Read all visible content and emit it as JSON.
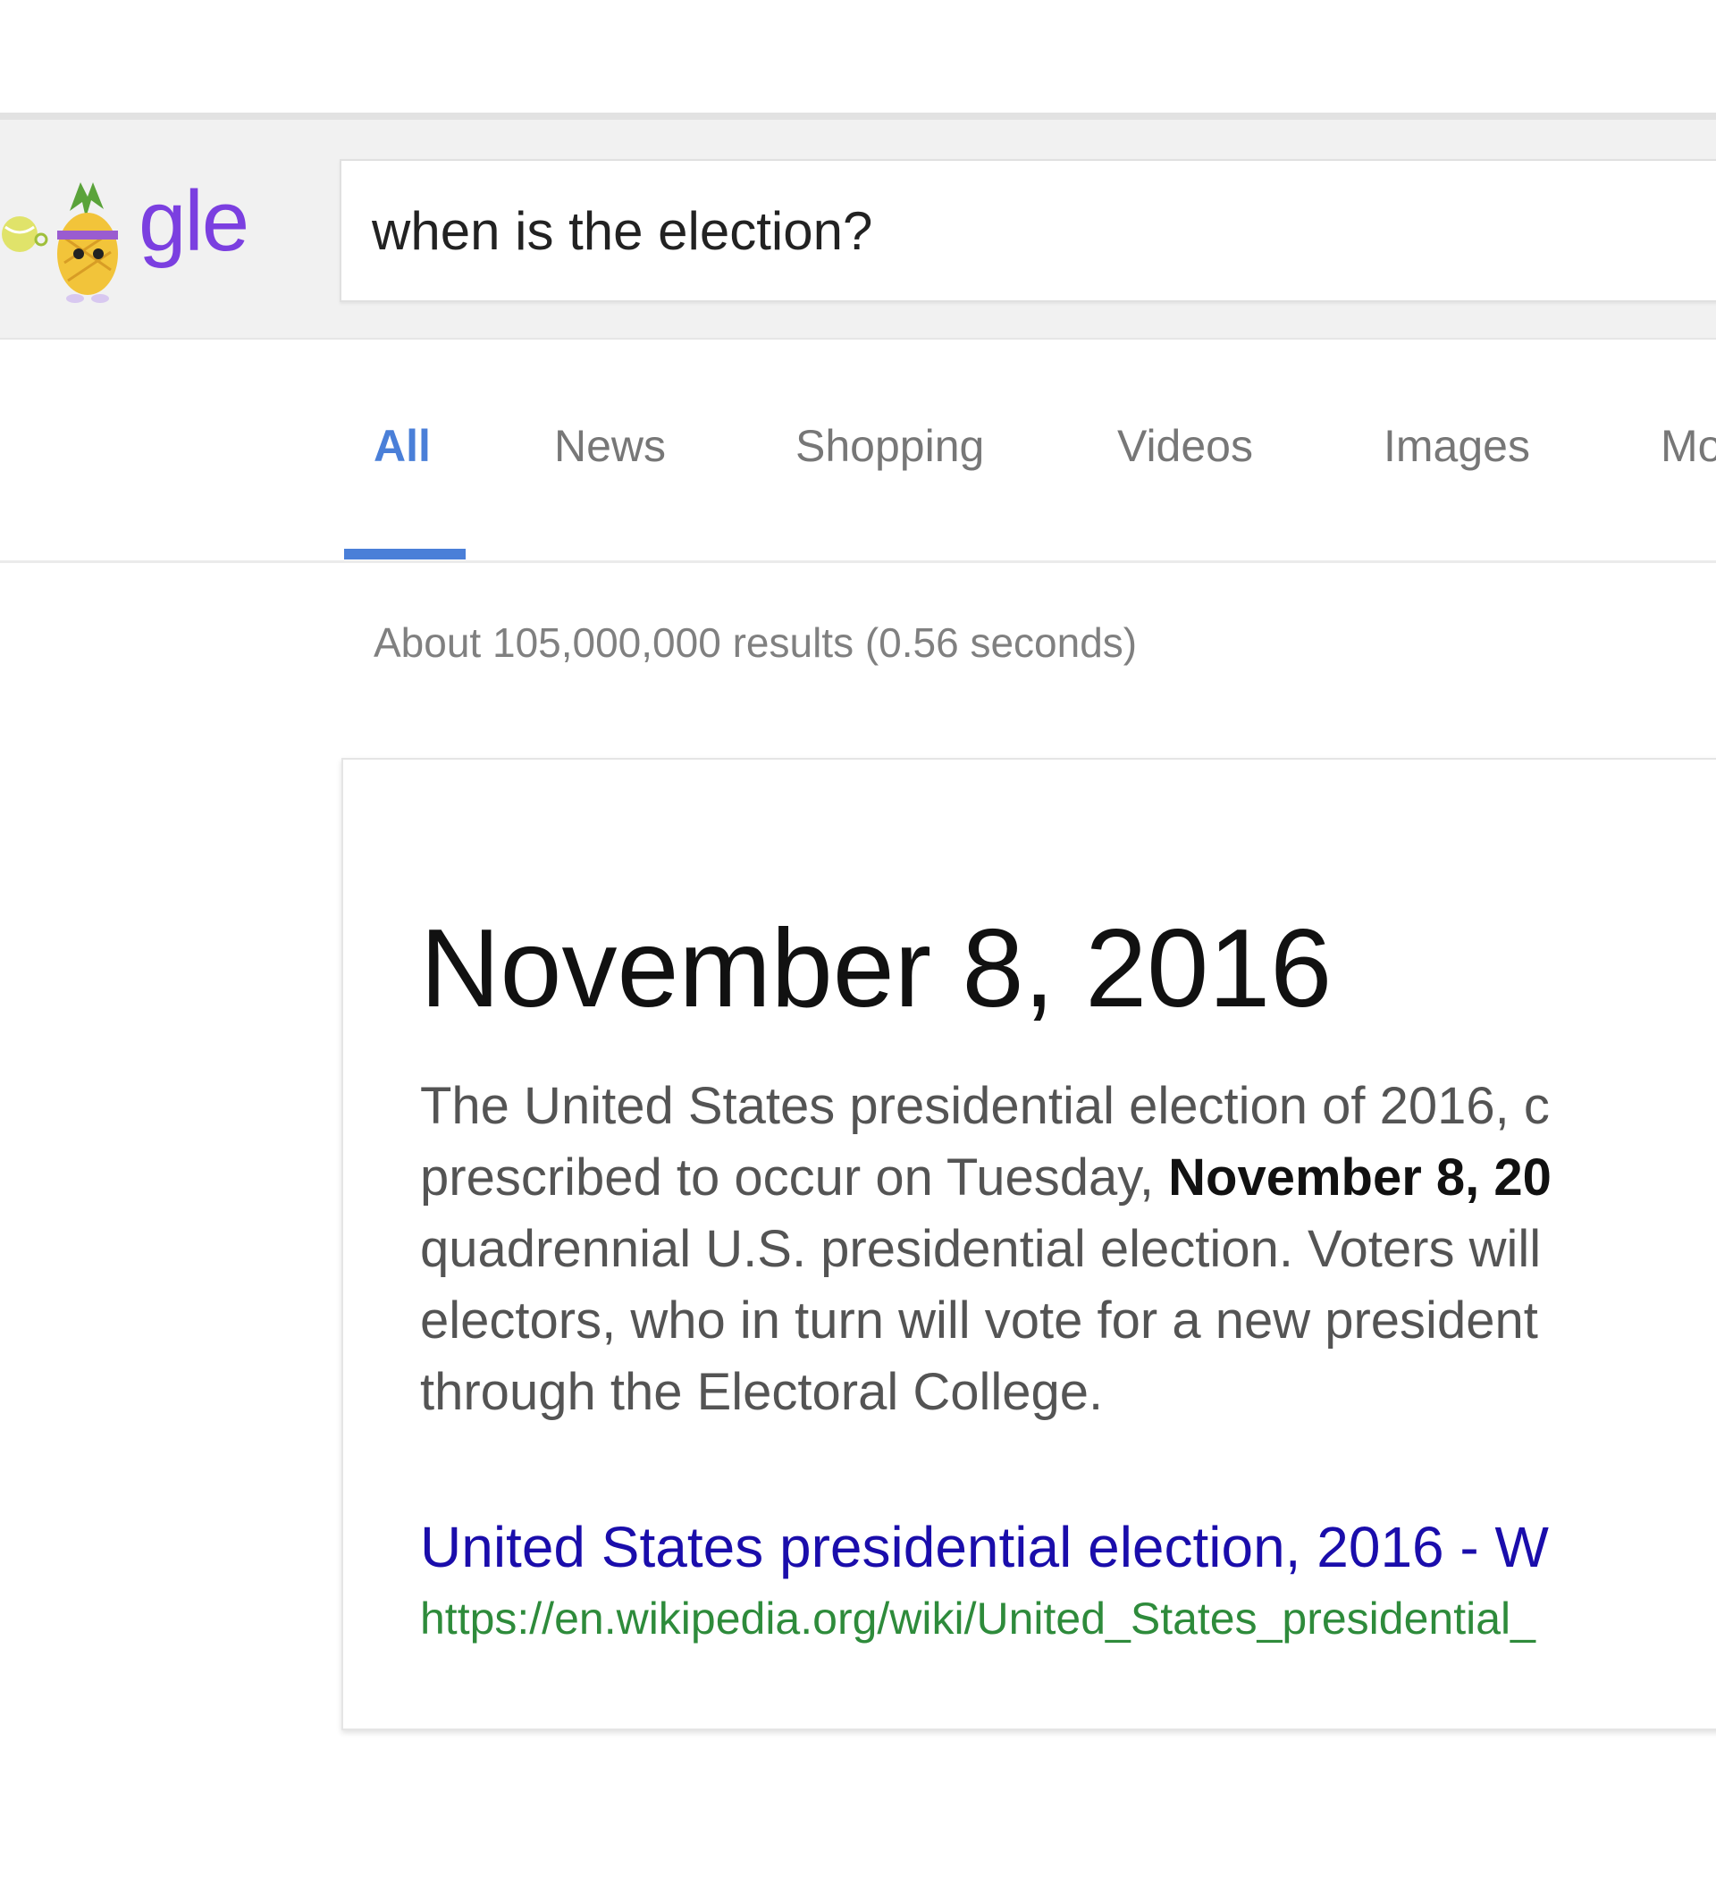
{
  "header": {
    "logo": {
      "text": "gle",
      "brand_color": "#7b3fe0",
      "doodle": "pineapple-doodle-icon"
    },
    "search": {
      "value": "when is the election?"
    }
  },
  "tabs": [
    {
      "label": "All",
      "active": true
    },
    {
      "label": "News",
      "active": false
    },
    {
      "label": "Shopping",
      "active": false
    },
    {
      "label": "Videos",
      "active": false
    },
    {
      "label": "Images",
      "active": false
    },
    {
      "label": "Mo",
      "active": false
    }
  ],
  "result_stats": "About 105,000,000 results (0.56 seconds)",
  "answer_card": {
    "title": "November 8, 2016",
    "snippet": {
      "line1": "The United States presidential election of 2016, c",
      "line2_pre": "prescribed to occur on Tuesday, ",
      "line2_bold": "November 8, 20",
      "line3": "quadrennial U.S. presidential election. Voters will",
      "line4": "electors, who in turn will vote for a new president",
      "line5": "through the Electoral College."
    },
    "source_title": "United States presidential election, 2016 - W",
    "source_url": "https://en.wikipedia.org/wiki/United_States_presidential_"
  },
  "colors": {
    "accent": "#4a7fd8",
    "link": "#1a0dab",
    "url": "#2e8b3b"
  }
}
